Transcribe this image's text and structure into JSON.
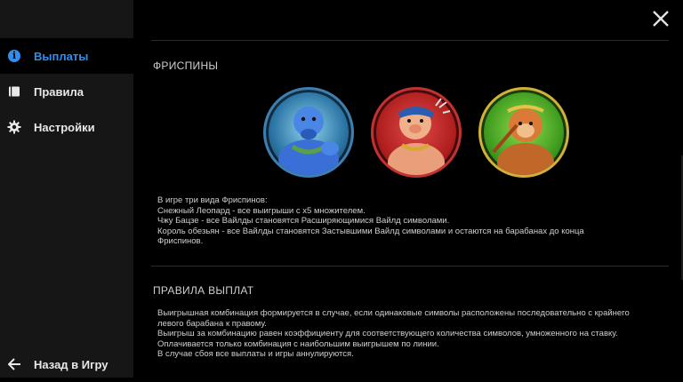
{
  "sidebar": {
    "items": [
      {
        "label": "Выплаты",
        "icon": "info-icon",
        "active": true
      },
      {
        "label": "Правила",
        "icon": "book-icon",
        "active": false
      },
      {
        "label": "Настройки",
        "icon": "gear-icon",
        "active": false
      }
    ],
    "back_label": "Назад в Игру"
  },
  "freespins": {
    "title": "ФРИСПИНЫ",
    "symbols": [
      {
        "icon": "snow-leopard-character-icon"
      },
      {
        "icon": "zhu-bajie-character-icon"
      },
      {
        "icon": "monkey-king-character-icon"
      }
    ],
    "lines": [
      "В игре три вида Фриспинов:",
      "Снежный Леопард - все выигрыши с х5 множителем.",
      "Чжу Бацзе - все Вайлды становятся Расширяющимися Вайлд символами.",
      "Король обезьян - все Вайлды становятся Застывшими Вайлд символами и остаются на барабанах до конца Фриспинов."
    ]
  },
  "payout_rules": {
    "title": "ПРАВИЛА ВЫПЛАТ",
    "lines": [
      "Выигрышная комбинация формируется в случае, если одинаковые символы расположены последовательно с крайнего левого барабана к правому.",
      "Выигрыш за комбинацию равен коэффициенту для соответствующего количества символов, умноженного на ставку.",
      "Оплачивается только комбинация с наибольшим выигрышем по линии.",
      "В случае сбоя все выплаты и игры аннулируются."
    ]
  },
  "colors": {
    "accent": "#2f8ff0",
    "sidebar_bg": "#161616",
    "main_bg": "#000000"
  }
}
